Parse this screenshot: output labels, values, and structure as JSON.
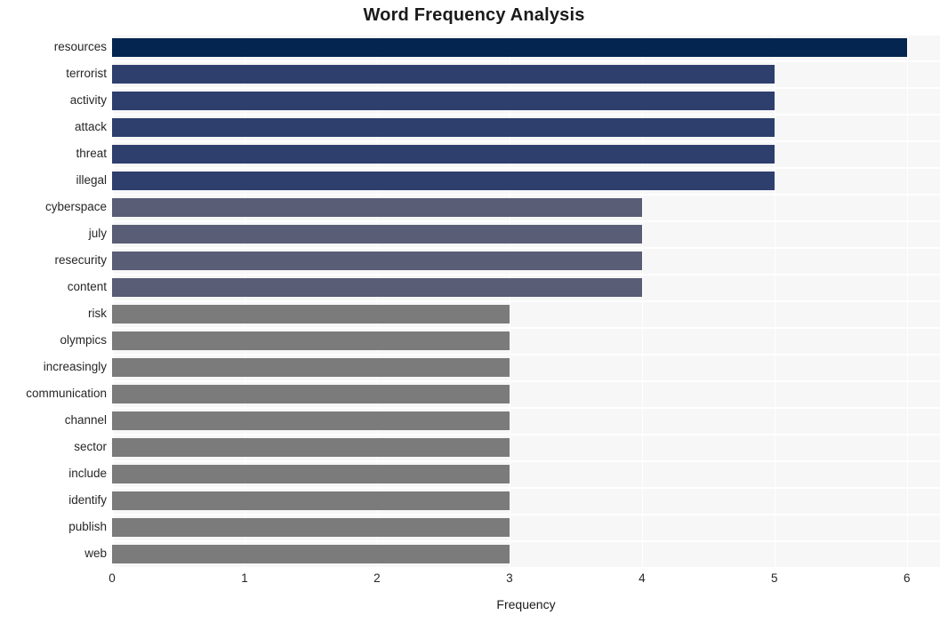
{
  "chart_data": {
    "type": "bar",
    "orientation": "horizontal",
    "title": "Word Frequency Analysis",
    "xlabel": "Frequency",
    "ylabel": "",
    "xlim": [
      0,
      6.25
    ],
    "xticks": [
      0,
      1,
      2,
      3,
      4,
      5,
      6
    ],
    "xtick_labels": [
      "0",
      "1",
      "2",
      "3",
      "4",
      "5",
      "6"
    ],
    "grid": true,
    "grid_color": "#ffffff",
    "legend": null,
    "plot_background": "#f7f7f7",
    "figure_background": "#ffffff",
    "categories": [
      "resources",
      "terrorist",
      "activity",
      "attack",
      "threat",
      "illegal",
      "cyberspace",
      "july",
      "resecurity",
      "content",
      "risk",
      "olympics",
      "increasingly",
      "communication",
      "channel",
      "sector",
      "include",
      "identify",
      "publish",
      "web"
    ],
    "values": [
      6,
      5,
      5,
      5,
      5,
      5,
      4,
      4,
      4,
      4,
      3,
      3,
      3,
      3,
      3,
      3,
      3,
      3,
      3,
      3
    ],
    "bar_colors": [
      "#04254f",
      "#2e3f6e",
      "#2e3f6e",
      "#2e3f6e",
      "#2e3f6e",
      "#2e3f6e",
      "#595d75",
      "#595d75",
      "#595d75",
      "#595d75",
      "#7b7b7b",
      "#7b7b7b",
      "#7b7b7b",
      "#7b7b7b",
      "#7b7b7b",
      "#7b7b7b",
      "#7b7b7b",
      "#7b7b7b",
      "#7b7b7b",
      "#7b7b7b"
    ],
    "palette": {
      "freq_6": "#04254f",
      "freq_5": "#2e3f6e",
      "freq_4": "#595d75",
      "freq_3": "#7b7b7b"
    }
  }
}
